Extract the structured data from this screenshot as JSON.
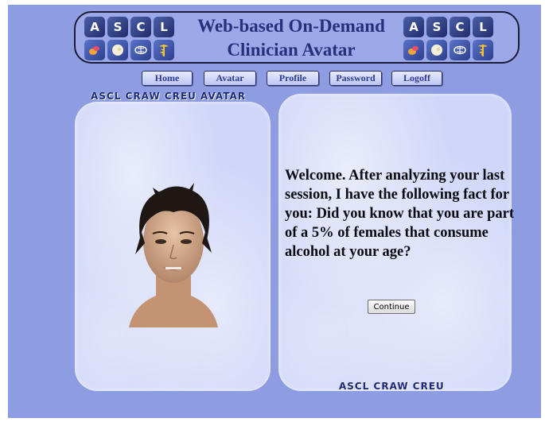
{
  "header": {
    "title_line1": "Web-based On-Demand",
    "title_line2": "Clinician Avatar",
    "logo_letters": [
      "A",
      "S",
      "C",
      "L"
    ],
    "logo_icons": [
      "pills-icon",
      "head-icon",
      "brain-circuit-icon",
      "caduceus-icon"
    ]
  },
  "nav": {
    "home": "Home",
    "avatar": "Avatar",
    "profile": "Profile",
    "password": "Password",
    "logoff": "Logoff"
  },
  "avatar_panel": {
    "caption": "ASCL CRAW CREU AVATAR"
  },
  "message_panel": {
    "text": "Welcome. After analyzing your last session, I have the following fact for you: Did you know that you are part of a 5% of females that consume alcohol at your age?",
    "continue_label": "Continue",
    "footer": "ASCL CRAW CREU"
  },
  "colors": {
    "page_bg": "#8e9ce2",
    "panel_bg": "#cfd6f8",
    "title": "#27307a"
  }
}
